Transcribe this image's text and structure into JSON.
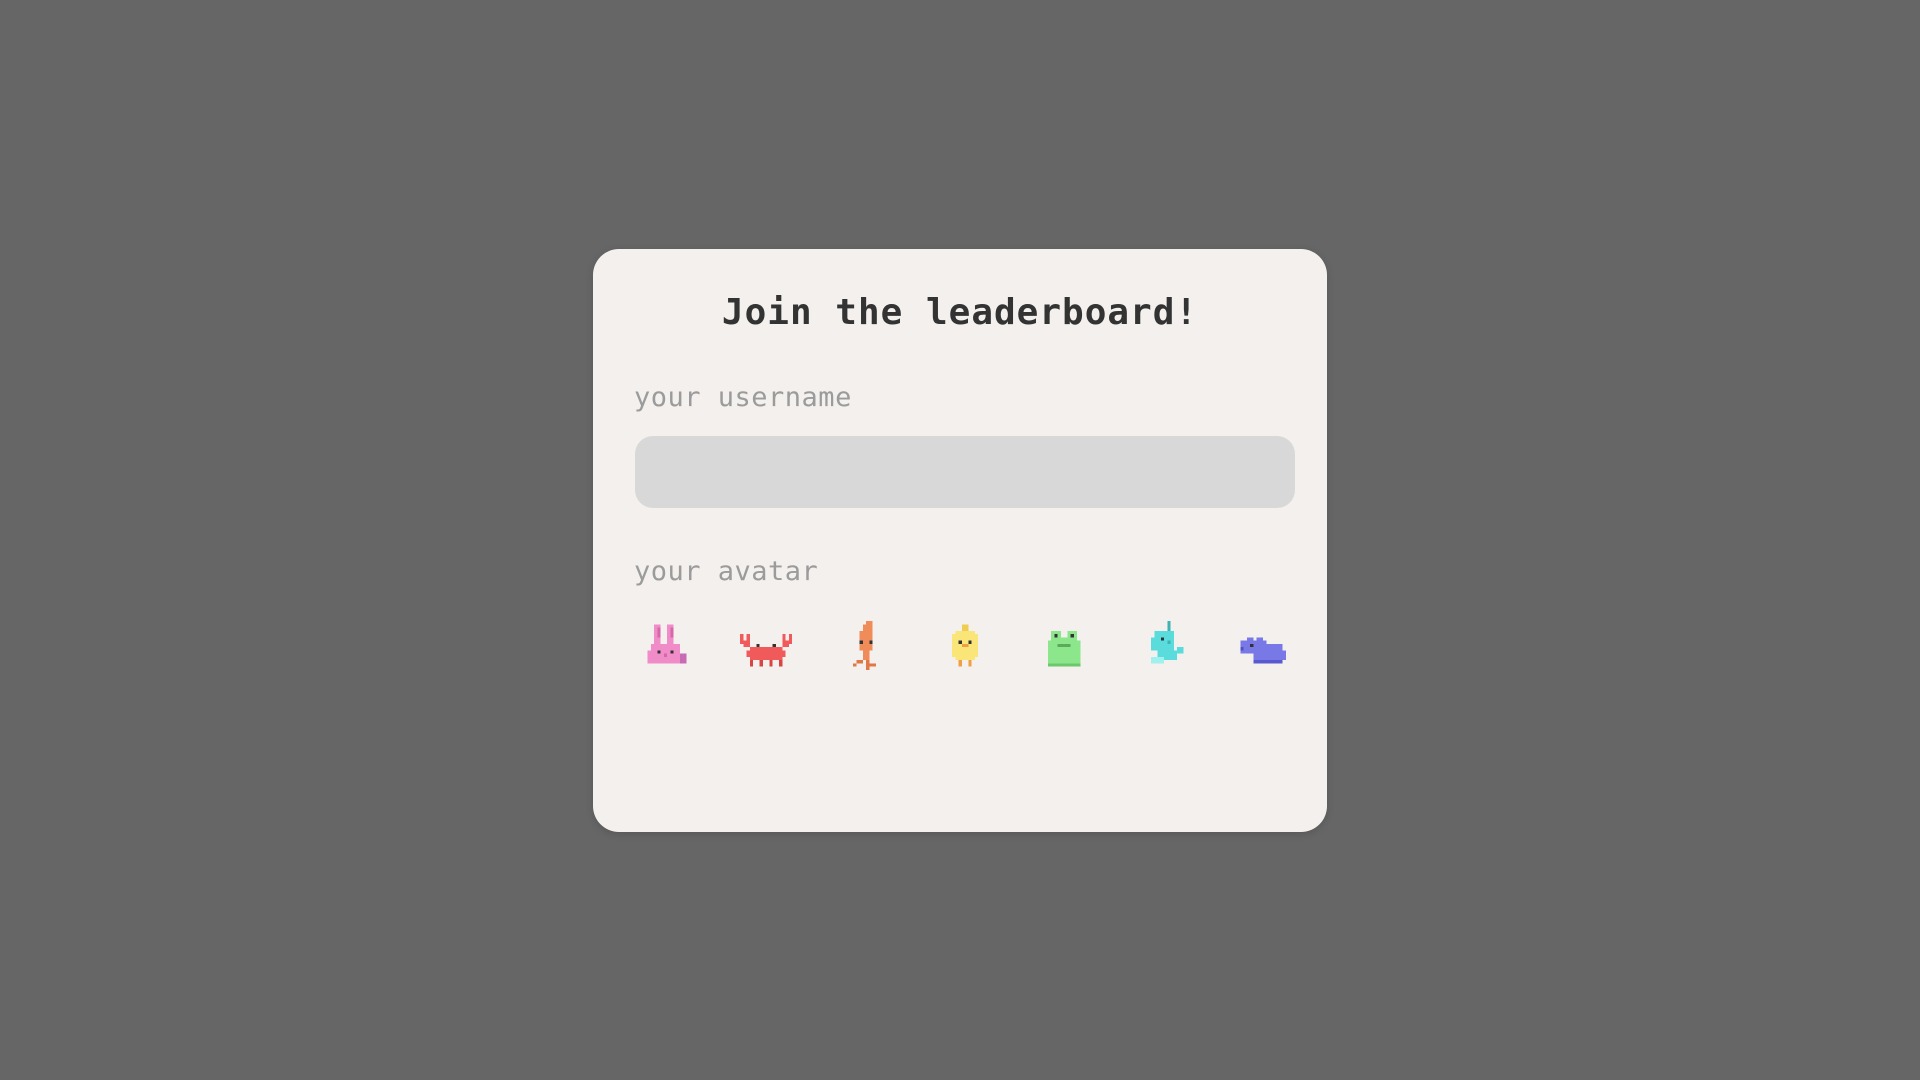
{
  "dialog": {
    "title": "Join the leaderboard!",
    "username_label": "your username",
    "username_value": "",
    "username_placeholder": "",
    "avatar_label": "your avatar"
  },
  "avatars": [
    {
      "name": "bunny",
      "color": "#f08cc8"
    },
    {
      "name": "crab",
      "color": "#f05a5a"
    },
    {
      "name": "squid",
      "color": "#f08c5a"
    },
    {
      "name": "chick",
      "color": "#fae678"
    },
    {
      "name": "frog",
      "color": "#8ce68c"
    },
    {
      "name": "narwhal",
      "color": "#5adcdc"
    },
    {
      "name": "hippo",
      "color": "#7878e6"
    }
  ],
  "colors": {
    "background": "#666666",
    "card": "#f3f0ed",
    "input": "#d8d8d8",
    "title": "#333333",
    "label": "#9b9b9b"
  }
}
